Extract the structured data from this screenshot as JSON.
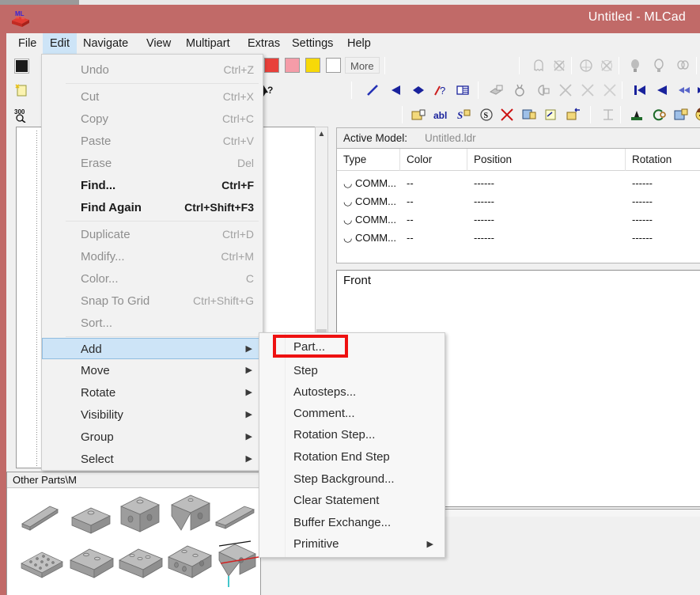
{
  "window": {
    "title": "Untitled - MLCad",
    "app_icon": "mlcad-brick-icon"
  },
  "menubar": {
    "items": [
      {
        "label": "File",
        "active": false
      },
      {
        "label": "Edit",
        "active": true
      },
      {
        "label": "Navigate",
        "active": false
      },
      {
        "label": "View",
        "active": false
      },
      {
        "label": "Multipart",
        "active": false
      },
      {
        "label": "Extras",
        "active": false
      },
      {
        "label": "Settings",
        "active": false
      },
      {
        "label": "Help",
        "active": false
      }
    ]
  },
  "toolbar": {
    "more_label": "More",
    "swatches": [
      "#e8403a",
      "#f59ca8",
      "#f7d908",
      "#ffffff"
    ],
    "zoom_value": "300",
    "icons_row1": [
      "ghost-icon",
      "delete-ghost-icon",
      "pivot-icon",
      "delete-pivot-icon",
      "bulb-icon",
      "bulb-outline-icon",
      "bulbs-icon"
    ],
    "icons_row2": [
      "line-icon",
      "left-arrow-icon",
      "diamond-icon",
      "question-line-icon",
      "grid-icon",
      "model-add-icon",
      "medal-icon",
      "lock-icon",
      "delete-a-icon",
      "delete-b-icon",
      "delete-c-icon",
      "first-icon",
      "prev-icon",
      "rewind-icon",
      "next-icon"
    ],
    "icons_row3": [
      "folder-add-icon",
      "abl-icon",
      "step-icon",
      "s-circle-icon",
      "delete-x-icon",
      "image-add-icon",
      "rotate-page-icon",
      "swap-folder-icon",
      "measure-icon",
      "stamp-icon",
      "rotate-target-icon",
      "picture-add-icon",
      "face-icon"
    ]
  },
  "edit_menu": {
    "groups": [
      [
        {
          "label": "Undo",
          "accel": "Ctrl+Z",
          "state": "disabled"
        }
      ],
      [
        {
          "label": "Cut",
          "accel": "Ctrl+X",
          "state": "disabled"
        },
        {
          "label": "Copy",
          "accel": "Ctrl+C",
          "state": "disabled"
        },
        {
          "label": "Paste",
          "accel": "Ctrl+V",
          "state": "disabled"
        },
        {
          "label": "Erase",
          "accel": "Del",
          "state": "disabled"
        },
        {
          "label": "Find...",
          "accel": "Ctrl+F",
          "state": "bold"
        },
        {
          "label": "Find Again",
          "accel": "Ctrl+Shift+F3",
          "state": "bold"
        }
      ],
      [
        {
          "label": "Duplicate",
          "accel": "Ctrl+D",
          "state": "disabled"
        },
        {
          "label": "Modify...",
          "accel": "Ctrl+M",
          "state": "disabled"
        },
        {
          "label": "Color...",
          "accel": "C",
          "state": "disabled"
        },
        {
          "label": "Snap To Grid",
          "accel": "Ctrl+Shift+G",
          "state": "disabled"
        },
        {
          "label": "Sort...",
          "accel": "",
          "state": "disabled"
        }
      ],
      [
        {
          "label": "Add",
          "accel": "",
          "state": "highlighted",
          "submenu": true
        },
        {
          "label": "Move",
          "accel": "",
          "state": "normal",
          "submenu": true
        },
        {
          "label": "Rotate",
          "accel": "",
          "state": "normal",
          "submenu": true
        },
        {
          "label": "Visibility",
          "accel": "",
          "state": "normal",
          "submenu": true
        },
        {
          "label": "Group",
          "accel": "",
          "state": "normal",
          "submenu": true
        },
        {
          "label": "Select",
          "accel": "",
          "state": "normal",
          "submenu": true
        }
      ]
    ]
  },
  "add_submenu": {
    "items": [
      {
        "label": "Part...",
        "submenu": false,
        "highlighted": true
      },
      {
        "label": "Step",
        "submenu": false,
        "highlighted": false
      },
      {
        "label": "Autosteps...",
        "submenu": false,
        "highlighted": false
      },
      {
        "label": "Comment...",
        "submenu": false,
        "highlighted": false
      },
      {
        "label": "Rotation Step...",
        "submenu": false,
        "highlighted": false
      },
      {
        "label": "Rotation End Step",
        "submenu": false,
        "highlighted": false
      },
      {
        "label": "Step Background...",
        "submenu": false,
        "highlighted": false
      },
      {
        "label": "Clear Statement",
        "submenu": false,
        "highlighted": false
      },
      {
        "label": "Buffer Exchange...",
        "submenu": false,
        "highlighted": false
      },
      {
        "label": "Primitive",
        "submenu": true,
        "highlighted": false
      }
    ],
    "annotation_color": "#ee1111"
  },
  "active_model": {
    "label": "Active Model:",
    "value": "Untitled.ldr"
  },
  "grid": {
    "columns": [
      "Type",
      "Color",
      "Position",
      "Rotation"
    ],
    "rows": [
      {
        "type": "COMM...",
        "color": "--",
        "position": "------",
        "rotation": "------"
      },
      {
        "type": "COMM...",
        "color": "--",
        "position": "------",
        "rotation": "------"
      },
      {
        "type": "COMM...",
        "color": "--",
        "position": "------",
        "rotation": "------"
      },
      {
        "type": "COMM...",
        "color": "--",
        "position": "------",
        "rotation": "------"
      }
    ]
  },
  "viewport": {
    "label": "Front"
  },
  "parts_panel": {
    "path": "Other Parts\\M"
  },
  "colors": {
    "titlebar": "#c16a68",
    "menu_highlight": "#cde4f7",
    "annotation_red": "#ee1111",
    "panel_bg": "#f0f0f0"
  }
}
